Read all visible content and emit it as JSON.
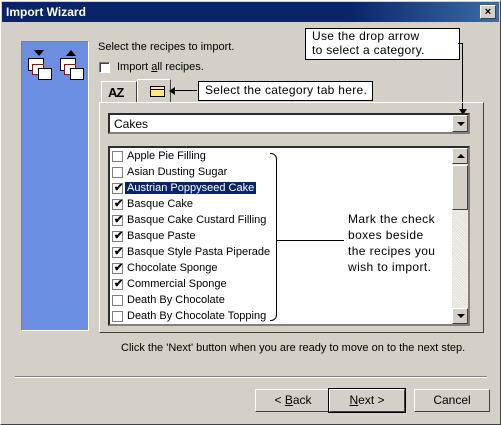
{
  "window": {
    "title": "Import Wizard",
    "close_glyph": "×"
  },
  "header": {
    "instruction": "Select the recipes to import.",
    "import_all_prefix": "Import ",
    "import_all_underline": "a",
    "import_all_suffix": "ll recipes."
  },
  "tabs": {
    "az_label": "AZ"
  },
  "callouts": {
    "dropdown_hint_line1": "Use the drop arrow",
    "dropdown_hint_line2": "to select a category.",
    "tab_hint": "Select the category tab here."
  },
  "category_dropdown": {
    "selected": "Cakes"
  },
  "recipes": [
    {
      "label": "Apple Pie Filling",
      "checked": false,
      "selected": false
    },
    {
      "label": "Asian Dusting Sugar",
      "checked": false,
      "selected": false
    },
    {
      "label": "Austrian Poppyseed Cake",
      "checked": true,
      "selected": true
    },
    {
      "label": "Basque Cake",
      "checked": true,
      "selected": false
    },
    {
      "label": "Basque Cake Custard Filling",
      "checked": true,
      "selected": false
    },
    {
      "label": "Basque Paste",
      "checked": true,
      "selected": false
    },
    {
      "label": "Basque Style Pasta Piperade",
      "checked": true,
      "selected": false
    },
    {
      "label": "Chocolate Sponge",
      "checked": true,
      "selected": false
    },
    {
      "label": "Commercial Sponge",
      "checked": true,
      "selected": false
    },
    {
      "label": "Death By Chocolate",
      "checked": false,
      "selected": false
    },
    {
      "label": "Death By Chocolate Topping",
      "checked": false,
      "selected": false
    }
  ],
  "note": {
    "line1": "Mark the check",
    "line2": "boxes beside",
    "line3": "the recipes you",
    "line4": "wish to import."
  },
  "footer_hint": "Click the 'Next' button when you are ready to move on to the next step.",
  "buttons": {
    "back_prefix": "< ",
    "back_u": "B",
    "back_rest": "ack",
    "next_u": "N",
    "next_rest": "ext >",
    "cancel": "Cancel"
  },
  "colors": {
    "titlebar": "#0a246a",
    "side_panel": "#6b8ee0",
    "selection": "#0a246a",
    "face": "#d4d0c8"
  },
  "icons": [
    "close-icon",
    "export-pages-icon",
    "import-pages-icon",
    "az-sort-icon",
    "folder-icon",
    "dropdown-arrow-icon",
    "scroll-up-icon",
    "scroll-down-icon"
  ]
}
